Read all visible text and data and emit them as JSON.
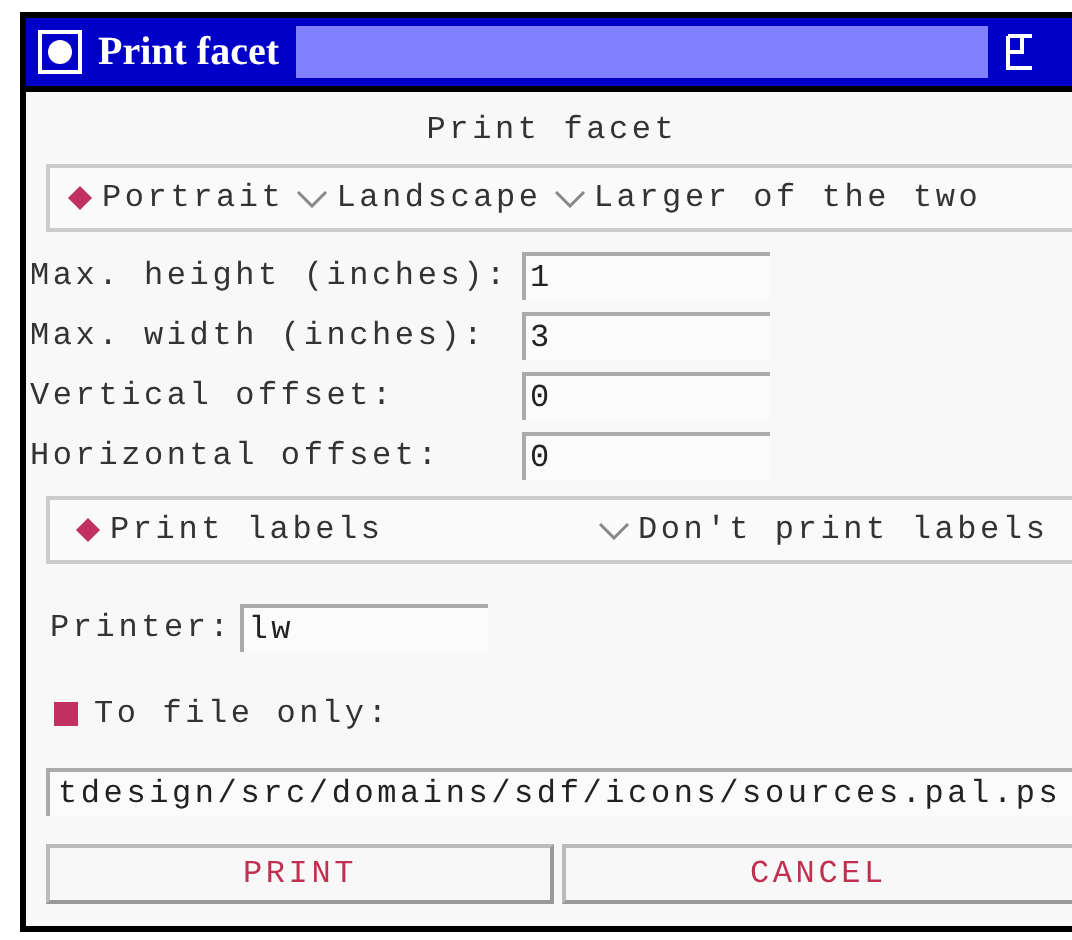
{
  "window": {
    "title": "Print facet"
  },
  "heading": "Print facet",
  "orientation": [
    {
      "label": "Portrait",
      "selected": true
    },
    {
      "label": "Landscape",
      "selected": false
    },
    {
      "label": "Larger of the two",
      "selected": false
    }
  ],
  "fields": [
    {
      "label": "Max. height (inches):",
      "value": "1"
    },
    {
      "label": "Max. width (inches):",
      "value": "3"
    },
    {
      "label": "Vertical offset:",
      "value": "0"
    },
    {
      "label": "Horizontal offset:",
      "value": "0"
    }
  ],
  "label_options": [
    {
      "label": "Print labels",
      "selected": true
    },
    {
      "label": "Don't print labels",
      "selected": false
    }
  ],
  "printer": {
    "label": "Printer:",
    "value": "lw"
  },
  "to_file": {
    "label": "To file only:",
    "checked": true
  },
  "file_path": "tdesign/src/domains/sdf/icons/sources.pal.ps",
  "buttons": [
    "PRINT",
    "CANCEL"
  ]
}
